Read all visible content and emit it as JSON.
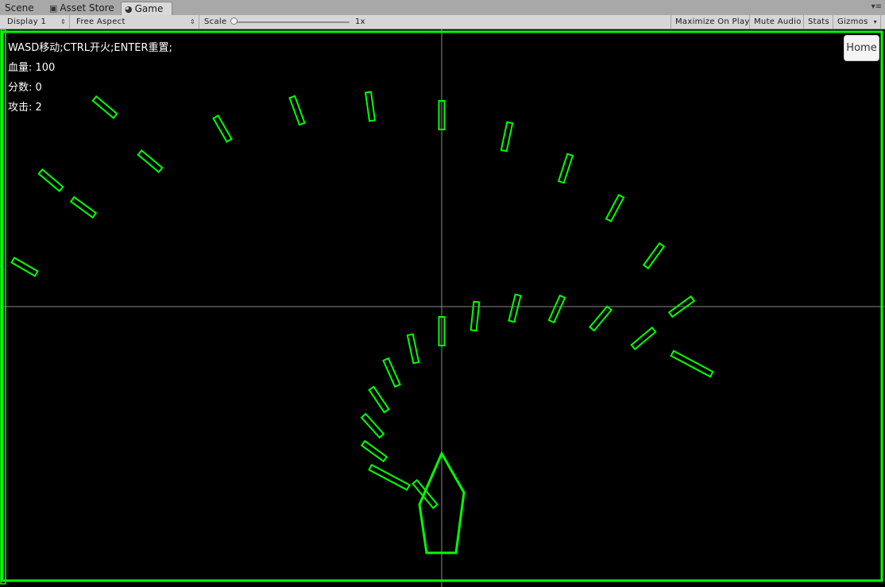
{
  "tabs": [
    {
      "label": "Scene",
      "icon": "scene-icon",
      "active": false
    },
    {
      "label": "Asset Store",
      "icon": "store-icon",
      "active": false
    },
    {
      "label": "Game",
      "icon": "game-icon",
      "active": true
    }
  ],
  "toolbar": {
    "display": "Display 1",
    "aspect": "Free Aspect",
    "scale_label": "Scale",
    "scale_value": "1x",
    "scale_fraction": 0.0,
    "maximize": "Maximize On Play",
    "mute": "Mute Audio",
    "stats": "Stats",
    "gizmos": "Gizmos"
  },
  "hud": {
    "controls": "WASD移动;CTRL开火;ENTER重置;",
    "health": "血量: 100",
    "score": "分数: 0",
    "attack": "攻击: 2"
  },
  "home_button": "Home",
  "colors": {
    "accent": "#00ff00",
    "background": "#000000",
    "crosshair": "#8a8a8a"
  }
}
